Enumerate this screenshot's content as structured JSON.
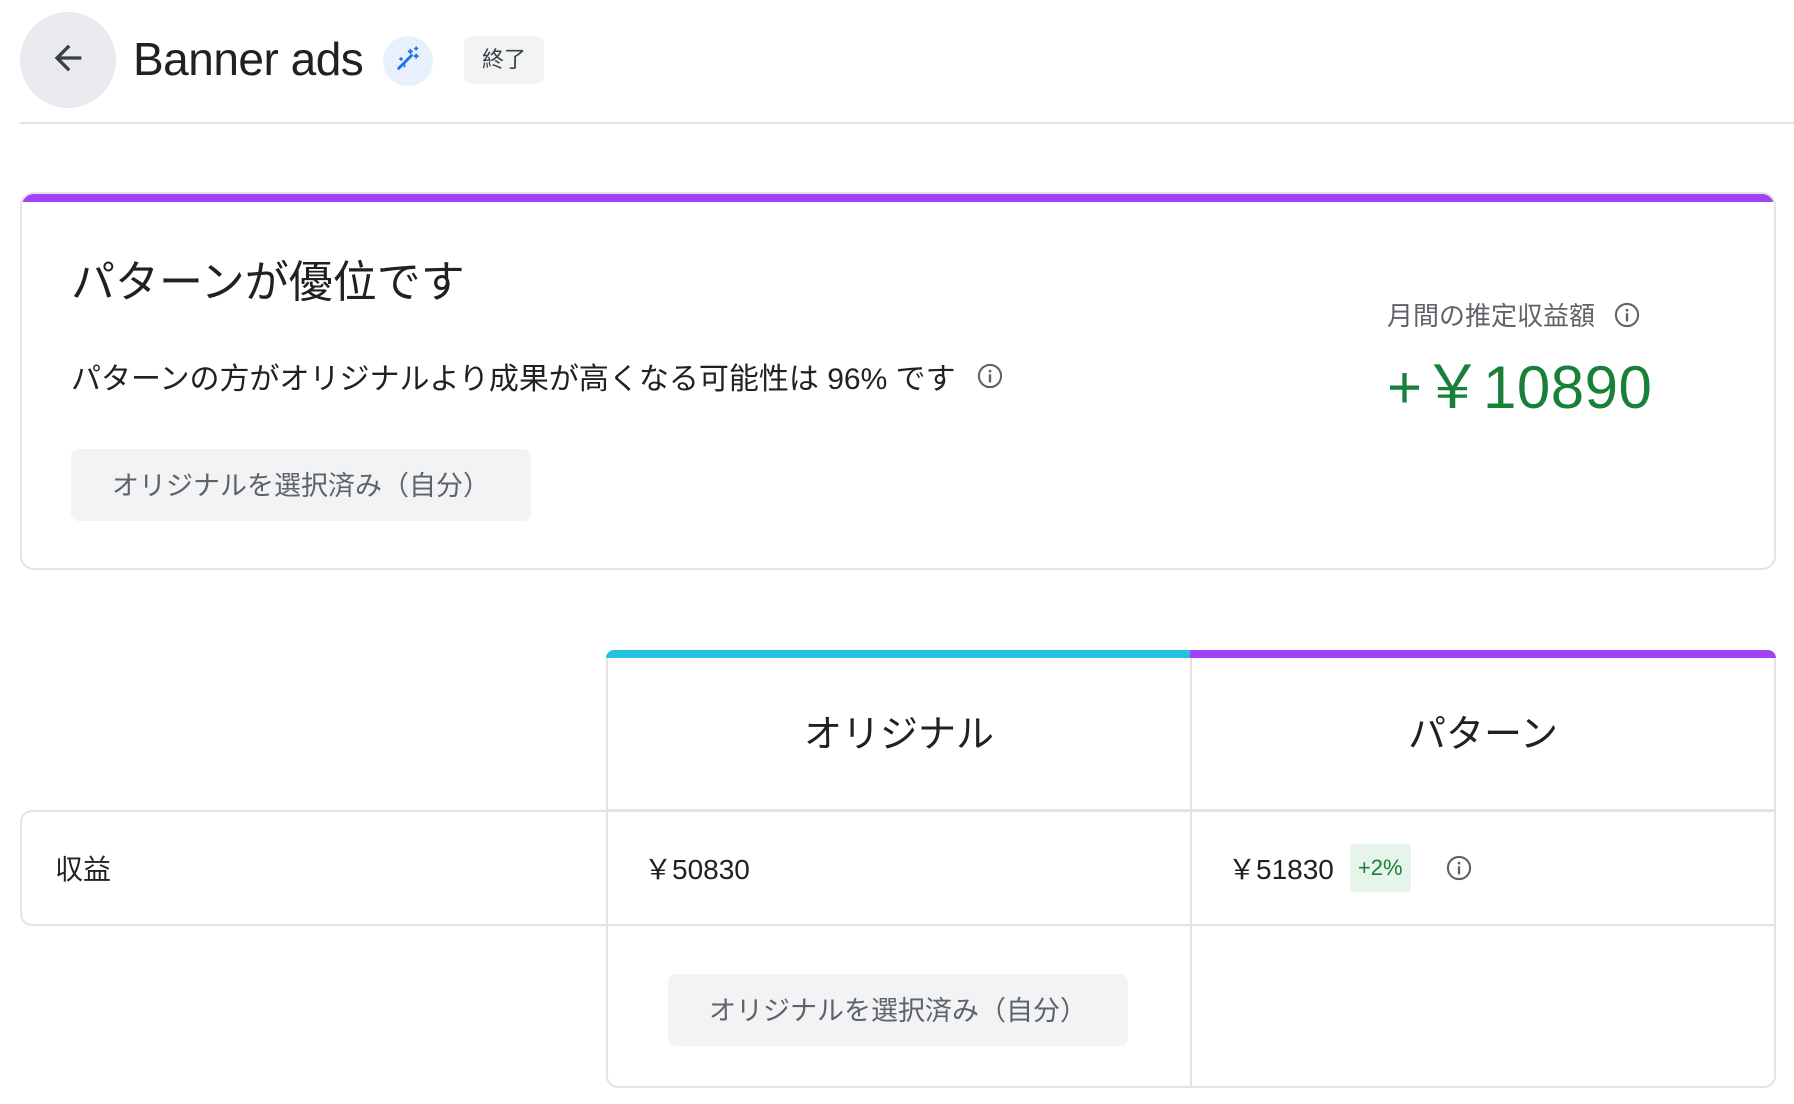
{
  "header": {
    "title": "Banner ads",
    "status_chip": "終了"
  },
  "result_card": {
    "heading": "パターンが優位です",
    "description": "パターンの方がオリジナルより成果が高くなる可能性は 96% です",
    "selected_button": "オリジナルを選択済み（自分）",
    "earnings_label": "月間の推定収益額",
    "earnings_value": "+￥10890",
    "accent_color": "#a142f4",
    "earnings_color": "#188038"
  },
  "comparison": {
    "columns": [
      {
        "label": "オリジナル",
        "color": "#24c1e0"
      },
      {
        "label": "パターン",
        "color": "#a142f4"
      }
    ],
    "rows": [
      {
        "label": "収益",
        "original_value": "￥50830",
        "pattern_value": "￥51830",
        "pattern_change": "+2%"
      }
    ],
    "selected_button": "オリジナルを選択済み（自分）"
  },
  "icons": {
    "back": "arrow-back-icon",
    "magic": "magic-wand-icon",
    "info": "info-icon"
  }
}
